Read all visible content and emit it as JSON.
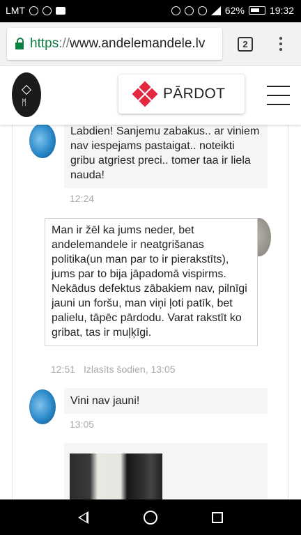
{
  "status_bar": {
    "carrier": "LMT",
    "left_icons": [
      "heart-monitor-icon",
      "chrome-icon",
      "youtube-icon"
    ],
    "right_icons": [
      "alarm-icon",
      "eye-comfort-icon",
      "wifi-icon",
      "signal-icon"
    ],
    "battery": "62%",
    "time": "19:32"
  },
  "browser": {
    "url_scheme": "https",
    "url_separator": "://",
    "url_host": "www.andelemandele.lv",
    "tab_count": "2"
  },
  "site_header": {
    "sell_label": "PĀRDOT",
    "accent_color": "#e4273f"
  },
  "chat": {
    "messages": [
      {
        "direction": "incoming",
        "text": "Labdien! Sanjemu zabakus.. ar viniem nav iespejams pastaigat.. noteikti gribu atgriest preci.. tomer taa ir liela nauda!",
        "time": "12:24"
      },
      {
        "direction": "outgoing",
        "text": "Man ir žēl ka jums neder, bet andelemandele ir neatgrišanas politika(un man par to ir pierakstīts), jums par to bija jāpadomā vispirms. Nekādus defektus zābakiem nav, pilnīgi jauni un foršu, man viņi ļoti patīk, bet palielu, tāpēc pārdodu. Varat rakstīt ko gribat, tas ir muļķīgi.",
        "time": "12:51",
        "read_status": "Izlasīts šodien, 13:05"
      },
      {
        "direction": "incoming",
        "text": "Vini nav jauni!",
        "time": "13:05"
      }
    ]
  }
}
